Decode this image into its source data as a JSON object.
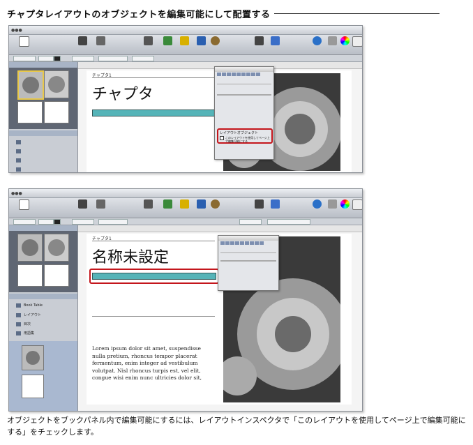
{
  "heading": "チャプタレイアウトのオブジェクトを編集可能にして配置する",
  "caption": "オブジェクトをブックパネル内で編集可能にするには、レイアウトインスペクタで「このレイアウトを使用してページ上で編集可能にする」をチェックします。",
  "shot1": {
    "chapter_small": "チャプタ1",
    "chapter_title": "チャプタ",
    "inspector_section": "レイアウトオブジェクト",
    "inspector_checkbox": "このレイアウトを使用してページ上で編集可能にする"
  },
  "shot2": {
    "chapter_small": "チャプタ1",
    "chapter_title": "名称未設定",
    "sidebar_items": [
      "Book Table",
      "レイアウト",
      "目次",
      "用語集"
    ],
    "lorem": "Lorem ipsum dolor sit amet, suspendisse nulla pretium, rhoncus tempor placerat fermentum, enim integer ad vestibulum volutpat. Nisl rhoncus turpis est, vel elit, congue wisi enim nunc ultricies dolor sit,"
  },
  "colors": {
    "highlight": "#c4161c",
    "accent_bar": "#55b4b8"
  }
}
